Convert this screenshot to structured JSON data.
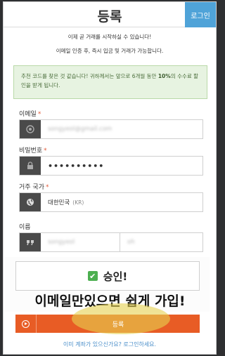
{
  "header": {
    "title": "등록",
    "login_label": "로그인"
  },
  "intro": {
    "line1": "이제 곧 거래를 시작하실 수 있습니다!",
    "line2": "이메일 인증 후, 즉시 입금 및 거래가 가능합니다."
  },
  "notice": {
    "text_before": "추천 코드를 찾은 것 같습니다! 귀하께서는 앞으로 6개월 동안 ",
    "highlight": "10%",
    "text_after": "의 수수료 할인을 받게 됩니다."
  },
  "form": {
    "email": {
      "label": "이메일",
      "required": "*",
      "value": "songyeol@gmail.com",
      "icon": "at-icon"
    },
    "password": {
      "label": "비밀번호",
      "required": "*",
      "value": "••••••••••",
      "icon": "lock-icon"
    },
    "country": {
      "label": "거주 국가",
      "required": "*",
      "value": "대한민국",
      "code": "(KR)",
      "icon": "globe-icon"
    },
    "name": {
      "label": "이름",
      "first_value": "songyeol",
      "last_value": "oh",
      "icon": "quote-icon"
    }
  },
  "approve": {
    "label": "승인!"
  },
  "caption": "이메일만있으면 쉽게 가입!",
  "register": {
    "label": "등록"
  },
  "footer": {
    "login_link": "이미 계좌가 있으신가요? 로그인하세요."
  },
  "colors": {
    "accent": "#4fa3d8",
    "register": "#e85c25",
    "check": "#4caf50",
    "notice_bg": "#e7f3e1"
  }
}
